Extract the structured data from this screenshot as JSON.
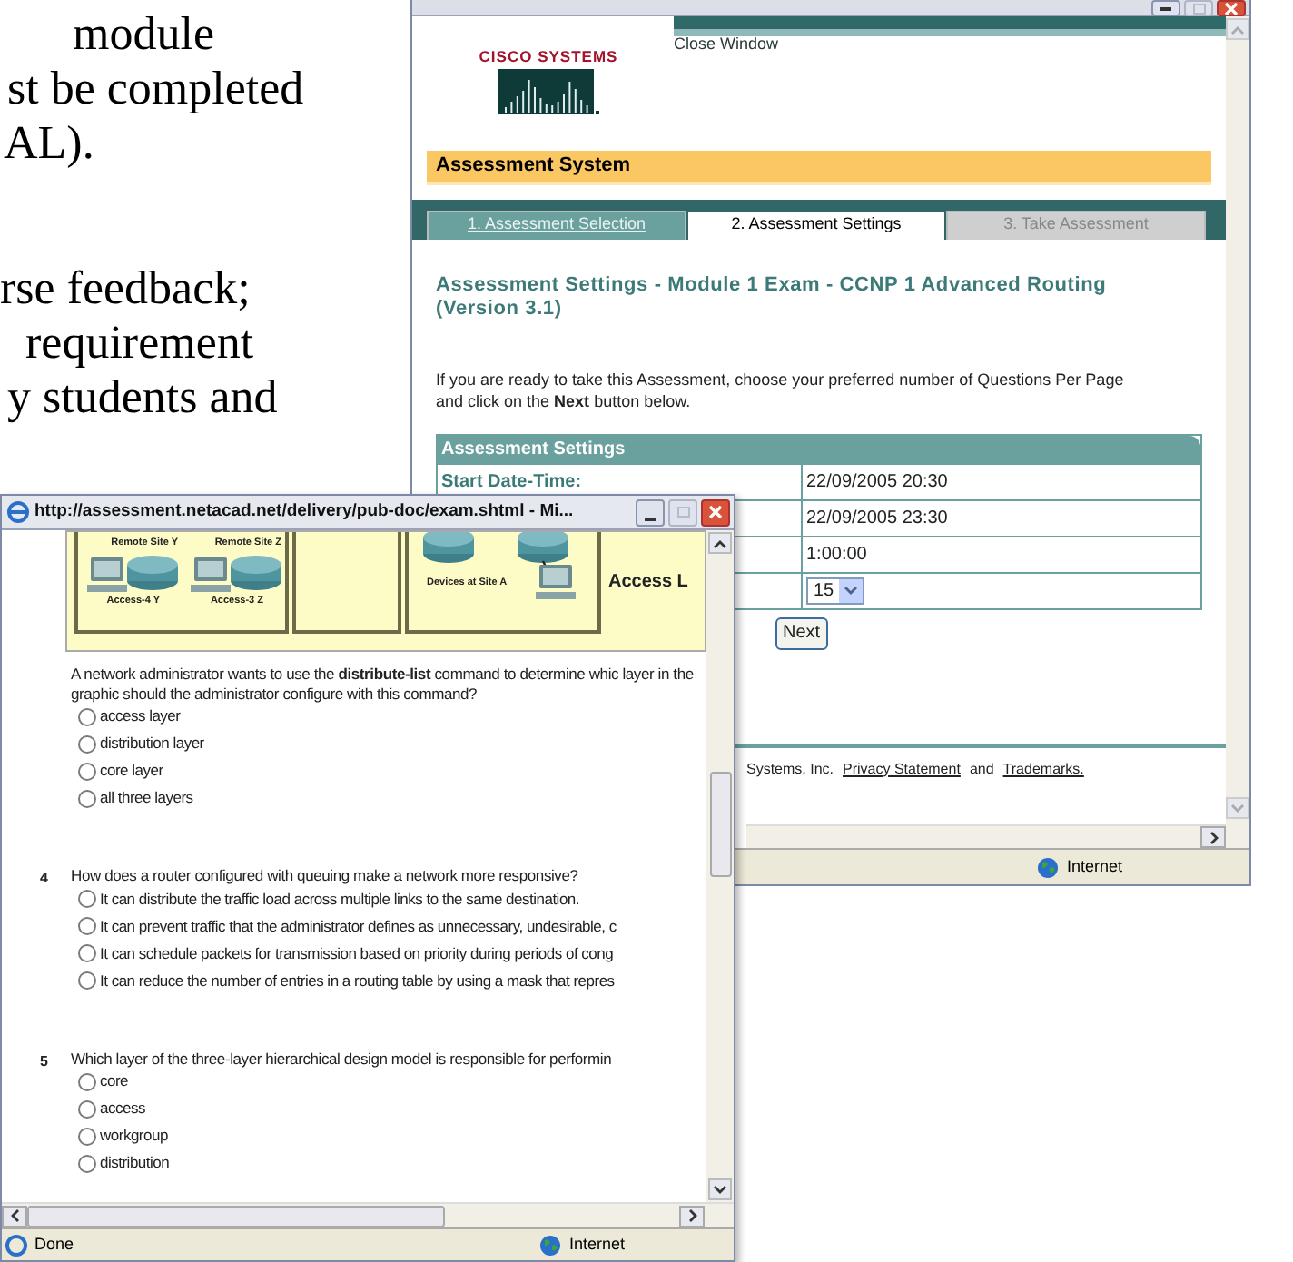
{
  "document": {
    "lines": [
      "module",
      "st be completed",
      "AL).",
      "rse feedback;",
      "requirement",
      "y students and"
    ]
  },
  "back_window": {
    "logo": "CISCO SYSTEMS",
    "close_link": "Close Window",
    "banner": "Assessment System",
    "tabs": [
      {
        "label": "1. Assessment Selection",
        "selected": false,
        "disabled": false
      },
      {
        "label": "2. Assessment Settings",
        "selected": true,
        "disabled": false
      },
      {
        "label": "3. Take Assessment",
        "selected": false,
        "disabled": true
      }
    ],
    "heading": "Assessment Settings - Module 1 Exam - CCNP 1 Advanced Routing (Version 3.1)",
    "intro": "If you are ready to take this Assessment, choose your preferred number of Questions Per Page and click on the **Next** button below.",
    "table": {
      "title": "Assessment Settings",
      "rows": [
        {
          "kind": "text",
          "label": "Start Date-Time:",
          "value": "22/09/2005 20:30"
        },
        {
          "kind": "text",
          "value": "22/09/2005 23:30"
        },
        {
          "kind": "text",
          "value": "1:00:00"
        },
        {
          "kind": "select",
          "value": "15"
        }
      ]
    },
    "next_button": "Next",
    "footer": {
      "text": "Systems, Inc.",
      "links": [
        "Privacy Statement",
        "Trademarks."
      ],
      "joiner": "and"
    },
    "status_bar": {
      "zone": "Internet"
    }
  },
  "front_window": {
    "title": "http://assessment.netacad.net/delivery/pub-doc/exam.shtml - Mi...",
    "diagram": {
      "sites": [
        {
          "name": "Remote Site Y",
          "device": "Access-4 Y"
        },
        {
          "name": "Remote Site Z",
          "device": "Access-3 Z"
        }
      ],
      "site_a": "Devices at Site A",
      "layer": "Access L"
    },
    "questions": [
      {
        "text": "A network administrator wants to use the **distribute-list** command to determine whic layer in the graphic should the administrator configure with this command?",
        "options": [
          {
            "label": "access layer",
            "selected": false
          },
          {
            "label": "distribution layer",
            "selected": false
          },
          {
            "label": "core layer",
            "selected": false
          },
          {
            "label": "all three layers",
            "selected": false
          }
        ]
      },
      {
        "number": "4",
        "text": "How does a router configured with queuing make a network more responsive?",
        "options": [
          {
            "label": "It can distribute the traffic load across multiple links to the same destination.",
            "selected": false
          },
          {
            "label": "It can prevent traffic that the administrator defines as unnecessary, undesirable, c",
            "selected": false
          },
          {
            "label": "It can schedule packets for transmission based on priority during periods of cong",
            "selected": false
          },
          {
            "label": "It can reduce the number of entries in a routing table by using a mask that repres",
            "selected": false
          }
        ]
      },
      {
        "number": "5",
        "text": "Which layer of the three-layer hierarchical design model is responsible for performin",
        "options": [
          {
            "label": "core",
            "selected": false
          },
          {
            "label": "access",
            "selected": false
          },
          {
            "label": "workgroup",
            "selected": false
          },
          {
            "label": "distribution",
            "selected": false
          }
        ]
      }
    ],
    "status_bar": {
      "left": "Done",
      "zone": "Internet"
    }
  }
}
